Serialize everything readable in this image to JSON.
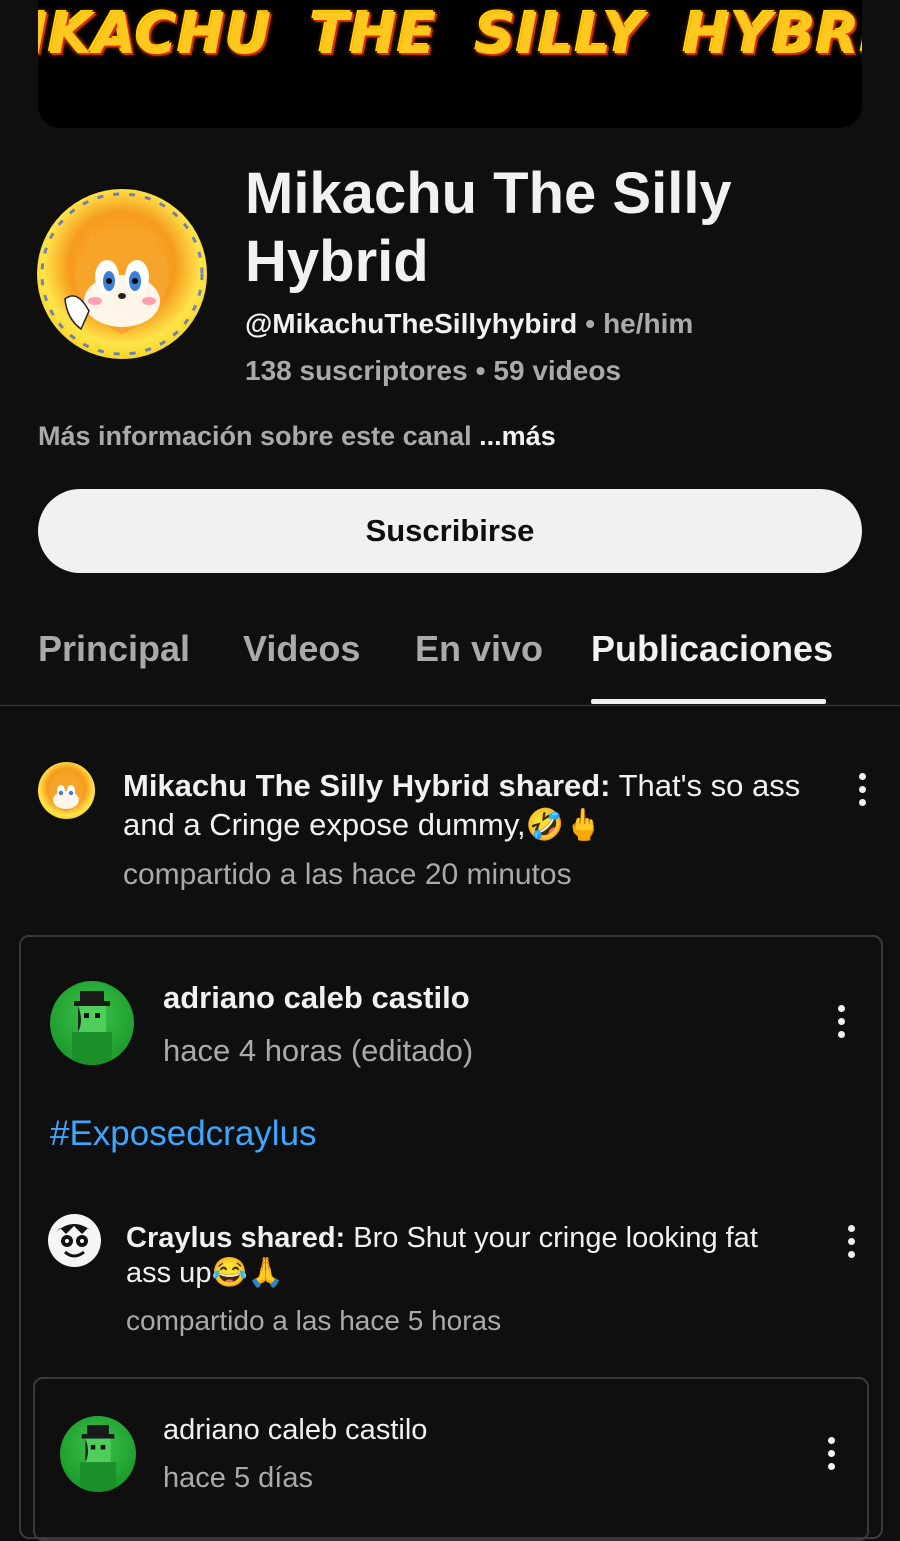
{
  "banner": {
    "text": "MIKACHU THE SILLY HYBRID"
  },
  "channel": {
    "name": "Mikachu The Silly Hybrid",
    "handle": "@MikachuTheSillyhybird",
    "pronouns": "he/him",
    "subscribers": "138 suscriptores",
    "videos": "59 videos",
    "more_info": "Más información sobre este canal",
    "more_link": "...más",
    "separator": "•"
  },
  "subscribe_label": "Suscribirse",
  "tabs": [
    {
      "label": "Principal",
      "active": false
    },
    {
      "label": "Videos",
      "active": false
    },
    {
      "label": "En vivo",
      "active": false
    },
    {
      "label": "Publicaciones",
      "active": true
    }
  ],
  "post": {
    "author_shared": "Mikachu The Silly Hybrid shared:",
    "text": " That's so ass and a Cringe expose dummy,🤣🖕",
    "time": "compartido a las hace 20 minutos"
  },
  "shared_post": {
    "author": "adriano caleb castilo",
    "time": "hace 4 horas (editado)",
    "hashtag": "#Exposedcraylus",
    "nested": {
      "author_shared": "Craylus shared:",
      "text": " Bro Shut your cringe looking fat ass up😂🙏",
      "time": "compartido a las hace 5 horas"
    },
    "inner": {
      "author": "adriano caleb castilo",
      "time": "hace 5 días"
    }
  },
  "colors": {
    "background": "#0f0f0f",
    "text": "#f1f1f1",
    "secondary": "#aaaaaa",
    "link": "#3ea6ff",
    "banner_text": "#ffc81e"
  }
}
